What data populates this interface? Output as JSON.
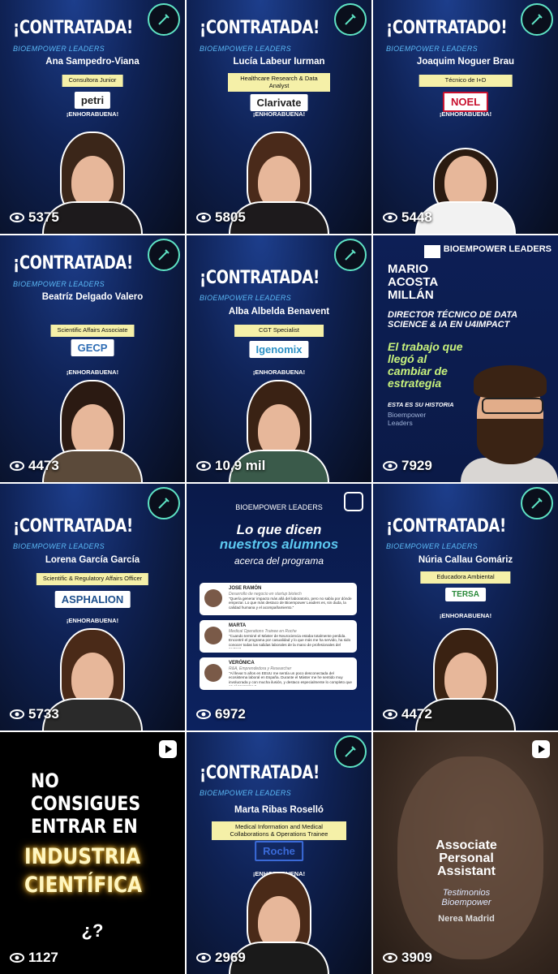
{
  "brand": "BIOEMPOWER LEADERS",
  "congrats": "¡ENHORABUENA!",
  "hires": [
    {
      "key": "t0",
      "heading": "¡CONTRATADA!",
      "name": "Ana Sampedro-Viana",
      "role": "Consultora Junior",
      "company": "petri",
      "views": "5375"
    },
    {
      "key": "t1",
      "heading": "¡CONTRATADA!",
      "name": "Lucía Labeur Iurman",
      "role": "Healthcare Research & Data Analyst",
      "company": "Clarivate",
      "views": "5805"
    },
    {
      "key": "t2",
      "heading": "¡CONTRATADO!",
      "name": "Joaquim Noguer Brau",
      "role": "Técnico de I+D",
      "company": "NOEL",
      "views": "5448"
    },
    {
      "key": "t3",
      "heading": "¡CONTRATADA!",
      "name": "Beatríz Delgado Valero",
      "role": "Scientific Affairs Associate",
      "company": "GECP",
      "views": "4473"
    },
    {
      "key": "t4",
      "heading": "¡CONTRATADA!",
      "name": "Alba Albelda Benavent",
      "role": "CGT Specialist",
      "company": "Igenomix",
      "views": "10,9 mil"
    },
    {
      "key": "t6",
      "heading": "¡CONTRATADA!",
      "name": "Lorena García García",
      "role": "Scientific & Regulatory Affairs Officer",
      "company": "ASPHALION",
      "views": "5733"
    },
    {
      "key": "t8",
      "heading": "¡CONTRATADA!",
      "name": "Núria Callau Gomáriz",
      "role": "Educadora Ambiental",
      "company": "TERSA",
      "views": "4472"
    },
    {
      "key": "t10",
      "heading": "¡CONTRATADA!",
      "name": "Marta Ribas Roselló",
      "role": "Medical Information and Medical Collaborations & Operations Trainee",
      "company": "Roche",
      "views": "2969"
    }
  ],
  "mario": {
    "logo": "BIOEMPOWER LEADERS",
    "name": "MARIO ACOSTA MILLÁN",
    "job": "DIRECTOR TÉCNICO DE DATA SCIENCE & IA EN U4IMPACT",
    "quote": "El trabajo que llegó al cambiar de estrategia",
    "story": "ESTA ES SU HISTORIA",
    "sub": "Bioempower Leaders",
    "views": "7929"
  },
  "testimonials": {
    "label": "BIOEMPOWER LEADERS",
    "title_1": "Lo que dicen",
    "title_2": "nuestros alumnos",
    "title_3": "acerca del programa",
    "cards": [
      {
        "name": "JOSE RAMÓN",
        "role": "Desarrollo de negocio en startup biotech",
        "text": "\"Quería generar impacto más allá del laboratorio, pero no sabía por dónde empezar. Lo que más destaco de Bioempower Leaders es, sin duda, la calidad humana y el acompañamiento.\""
      },
      {
        "name": "MARTA",
        "role": "Medical Operations Trainee en Roche",
        "text": "\"Cuando terminé el Máster de Neurociencia estaba totalmente perdida. Encontré el programa por casualidad y lo que más me ha servido, ha sido conocer todas las salidas laborales de la mano de profesionales del sector.\""
      },
      {
        "name": "VERÓNICA",
        "role": "R&A, Emprendedora y Researcher",
        "text": "\"Al llevar 5 años en EEUU me sentía un poco desconectada del ecosistema laboral en España. Durante el Máster me he sentido muy involucrada y con mucha ilusión, y destaco especialmente lo completo que es el programa.\""
      }
    ],
    "views": "6972"
  },
  "no_entrar": {
    "line_1": "NO CONSIGUES ENTRAR EN",
    "line_2": "INDUSTRIA CIENTÍFICA",
    "question": "¿?",
    "views": "1127"
  },
  "nerea": {
    "title": "Associate Personal Assistant",
    "subtitle": "Testimonios Bioempower",
    "name": "Nerea Madrid",
    "views": "3909"
  },
  "colors": {
    "accent": "#5bb8f5",
    "role_bg": "#f5f0a8",
    "badge_ring": "#5ee3c4",
    "quote": "#c8f27c"
  }
}
